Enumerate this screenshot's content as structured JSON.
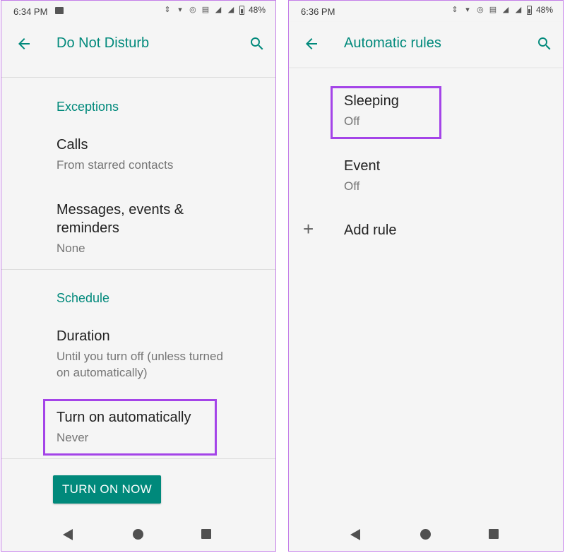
{
  "left": {
    "status": {
      "time": "6:34 PM",
      "battery": "48%"
    },
    "appbar": {
      "title": "Do Not Disturb"
    },
    "exceptions": {
      "header": "Exceptions",
      "items": [
        {
          "title": "Calls",
          "subtitle": "From starred contacts"
        },
        {
          "title_line1": "Messages, events &",
          "title_line2": "reminders",
          "subtitle": "None"
        }
      ]
    },
    "schedule": {
      "header": "Schedule",
      "duration": {
        "title": "Duration",
        "subtitle_line1": "Until you turn off (unless turned",
        "subtitle_line2": "on automatically)"
      },
      "turn_on_automatically": {
        "title": "Turn on automatically",
        "subtitle": "Never"
      }
    },
    "button": {
      "label": "TURN ON NOW"
    }
  },
  "right": {
    "status": {
      "time": "6:36 PM",
      "battery": "48%"
    },
    "appbar": {
      "title": "Automatic rules"
    },
    "rules": [
      {
        "title": "Sleeping",
        "subtitle": "Off"
      },
      {
        "title": "Event",
        "subtitle": "Off"
      }
    ],
    "add_rule": {
      "label": "Add rule"
    }
  },
  "colors": {
    "accent": "#00897b",
    "highlight": "#a444e8",
    "background": "#f5f5f5"
  }
}
